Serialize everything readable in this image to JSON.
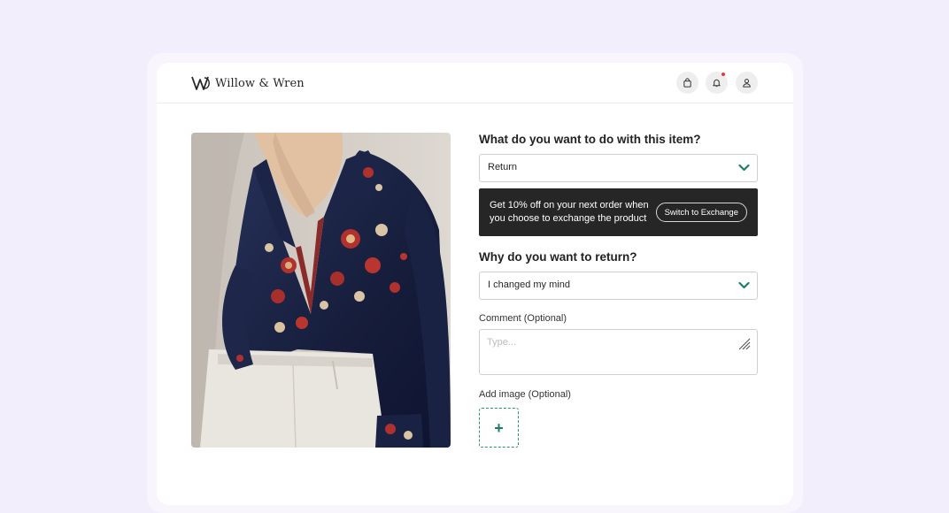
{
  "brand": {
    "name": "Willow & Wren"
  },
  "header": {
    "icons": [
      "shopping-bag-icon",
      "bell-icon",
      "user-icon"
    ],
    "notification_dot_color": "#e53935"
  },
  "product": {
    "image_alt": ""
  },
  "form": {
    "action_question": "What do you want to do with this item?",
    "action_value": "Return",
    "promo_text": "Get 10% off on your next order when you choose to exchange the product",
    "switch_button_label": "Switch to Exchange",
    "reason_question": "Why do you want to return?",
    "reason_value": "I changed my mind",
    "comment_label": "Comment (Optional)",
    "comment_placeholder": "Type...",
    "comment_value": "",
    "add_image_label": "Add image (Optional)",
    "add_image_symbol": "+"
  },
  "colors": {
    "background": "#f3eefc",
    "accent": "#1f7f66",
    "promo_background": "#262626"
  }
}
